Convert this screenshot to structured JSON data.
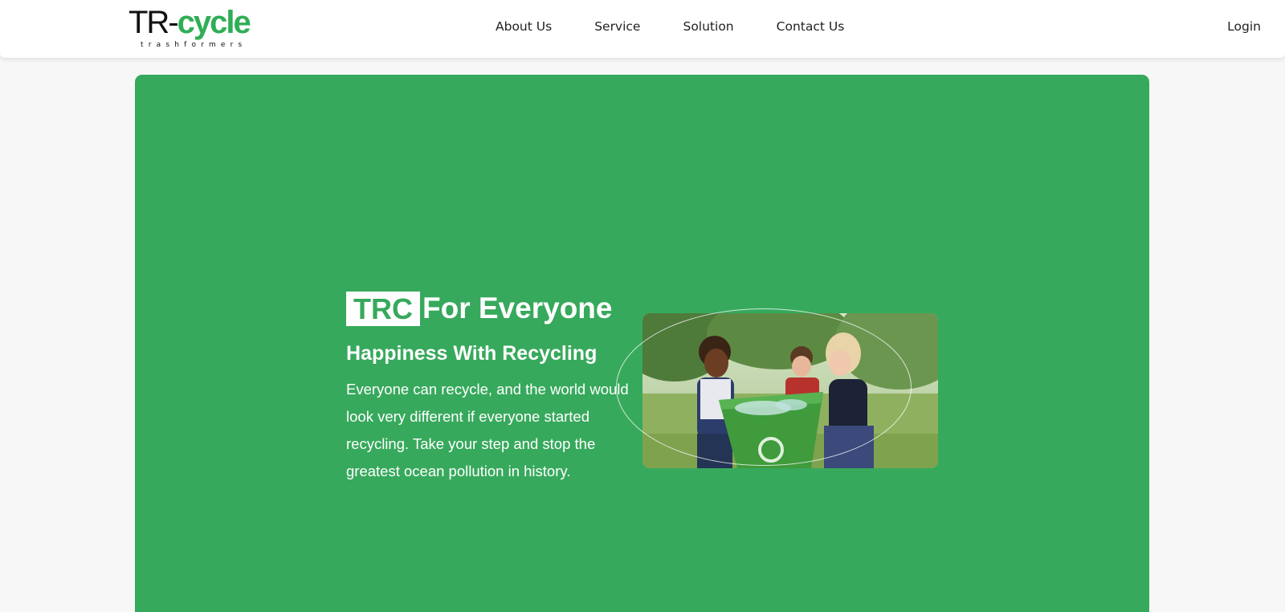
{
  "brand": {
    "name_dark": "TR-",
    "name_green": "cycle",
    "tagline": "trashformers"
  },
  "nav": {
    "links": [
      "About Us",
      "Service",
      "Solution",
      "Contact Us"
    ],
    "login": "Login"
  },
  "hero": {
    "badge": "TRC",
    "title_rest": "For Everyone",
    "subtitle": "Happiness With Recycling",
    "description": "Everyone can recycle, and the world would look very different if everyone started recycling. Take your step and stop the greatest ocean pollution in history.",
    "image_icon": "photo-children-recycling"
  },
  "colors": {
    "accent": "#37a95c",
    "logo_green": "#2fae55",
    "background": "#f7f7f7"
  }
}
